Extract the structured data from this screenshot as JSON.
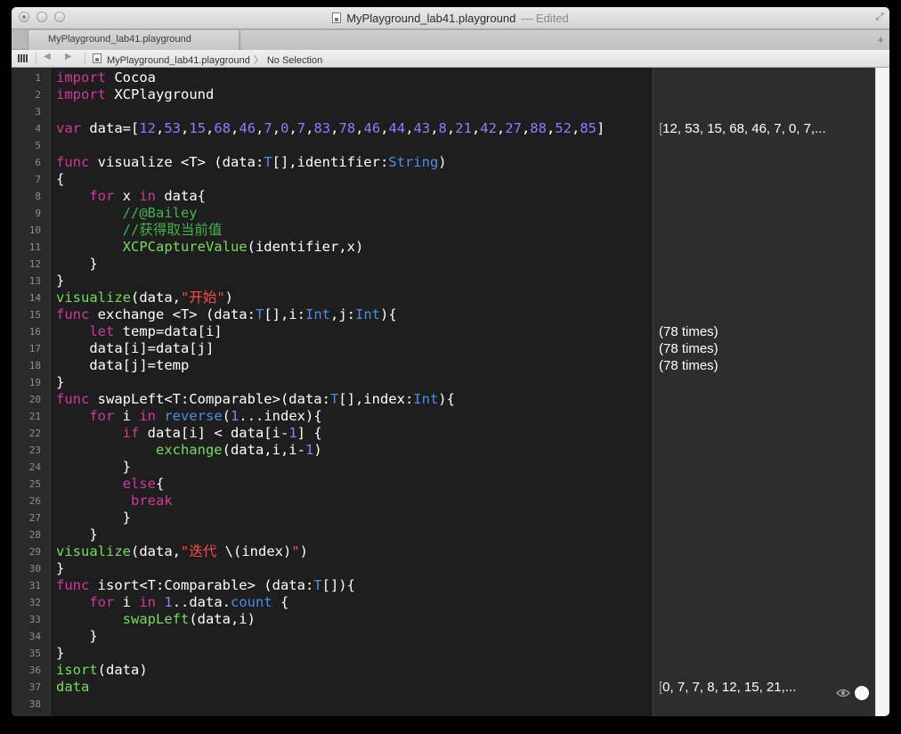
{
  "window": {
    "title": "MyPlayground_lab41.playground",
    "status": "— Edited",
    "tab_label": "MyPlayground_lab41.playground",
    "tab_add": "+"
  },
  "jumpbar": {
    "file": "MyPlayground_lab41.playground",
    "selection": "No Selection",
    "back": "◀",
    "forward": "▶"
  },
  "editor": {
    "line_numbers": [
      "1",
      "2",
      "3",
      "4",
      "5",
      "6",
      "7",
      "8",
      "9",
      "10",
      "11",
      "12",
      "13",
      "14",
      "15",
      "16",
      "17",
      "18",
      "19",
      "20",
      "21",
      "22",
      "23",
      "24",
      "25",
      "26",
      "27",
      "28",
      "29",
      "30",
      "31",
      "32",
      "33",
      "34",
      "35",
      "36",
      "37",
      "38"
    ],
    "lines": [
      [
        {
          "c": "kw",
          "t": "import"
        },
        {
          "c": "pl",
          "t": " Cocoa"
        }
      ],
      [
        {
          "c": "kw",
          "t": "import"
        },
        {
          "c": "pl",
          "t": " XCPlayground"
        }
      ],
      [],
      [
        {
          "c": "kw",
          "t": "var"
        },
        {
          "c": "pl",
          "t": " data=["
        },
        {
          "c": "num",
          "t": "12"
        },
        {
          "c": "pl",
          "t": ","
        },
        {
          "c": "num",
          "t": "53"
        },
        {
          "c": "pl",
          "t": ","
        },
        {
          "c": "num",
          "t": "15"
        },
        {
          "c": "pl",
          "t": ","
        },
        {
          "c": "num",
          "t": "68"
        },
        {
          "c": "pl",
          "t": ","
        },
        {
          "c": "num",
          "t": "46"
        },
        {
          "c": "pl",
          "t": ","
        },
        {
          "c": "num",
          "t": "7"
        },
        {
          "c": "pl",
          "t": ","
        },
        {
          "c": "num",
          "t": "0"
        },
        {
          "c": "pl",
          "t": ","
        },
        {
          "c": "num",
          "t": "7"
        },
        {
          "c": "pl",
          "t": ","
        },
        {
          "c": "num",
          "t": "83"
        },
        {
          "c": "pl",
          "t": ","
        },
        {
          "c": "num",
          "t": "78"
        },
        {
          "c": "pl",
          "t": ","
        },
        {
          "c": "num",
          "t": "46"
        },
        {
          "c": "pl",
          "t": ","
        },
        {
          "c": "num",
          "t": "44"
        },
        {
          "c": "pl",
          "t": ","
        },
        {
          "c": "num",
          "t": "43"
        },
        {
          "c": "pl",
          "t": ","
        },
        {
          "c": "num",
          "t": "8"
        },
        {
          "c": "pl",
          "t": ","
        },
        {
          "c": "num",
          "t": "21"
        },
        {
          "c": "pl",
          "t": ","
        },
        {
          "c": "num",
          "t": "42"
        },
        {
          "c": "pl",
          "t": ","
        },
        {
          "c": "num",
          "t": "27"
        },
        {
          "c": "pl",
          "t": ","
        },
        {
          "c": "num",
          "t": "88"
        },
        {
          "c": "pl",
          "t": ","
        },
        {
          "c": "num",
          "t": "52"
        },
        {
          "c": "pl",
          "t": ","
        },
        {
          "c": "num",
          "t": "85"
        },
        {
          "c": "pl",
          "t": "]"
        }
      ],
      [],
      [
        {
          "c": "kw",
          "t": "func"
        },
        {
          "c": "pl",
          "t": " visualize <T> (data:"
        },
        {
          "c": "ty",
          "t": "T"
        },
        {
          "c": "pl",
          "t": "[],identifier:"
        },
        {
          "c": "ty",
          "t": "String"
        },
        {
          "c": "pl",
          "t": ")"
        }
      ],
      [
        {
          "c": "pl",
          "t": "{"
        }
      ],
      [
        {
          "c": "pl",
          "t": "    "
        },
        {
          "c": "kw",
          "t": "for"
        },
        {
          "c": "pl",
          "t": " x "
        },
        {
          "c": "kw",
          "t": "in"
        },
        {
          "c": "pl",
          "t": " data{"
        }
      ],
      [
        {
          "c": "cm",
          "t": "        //@Bailey"
        }
      ],
      [
        {
          "c": "cm",
          "t": "        //获得取当前值"
        }
      ],
      [
        {
          "c": "pl",
          "t": "        "
        },
        {
          "c": "fn",
          "t": "XCPCaptureValue"
        },
        {
          "c": "pl",
          "t": "(identifier,x)"
        }
      ],
      [
        {
          "c": "pl",
          "t": "    }"
        }
      ],
      [
        {
          "c": "pl",
          "t": "}"
        }
      ],
      [
        {
          "c": "fn",
          "t": "visualize"
        },
        {
          "c": "pl",
          "t": "(data,"
        },
        {
          "c": "str",
          "t": "\"开始\""
        },
        {
          "c": "pl",
          "t": ")"
        }
      ],
      [
        {
          "c": "kw",
          "t": "func"
        },
        {
          "c": "pl",
          "t": " exchange <T> (data:"
        },
        {
          "c": "ty",
          "t": "T"
        },
        {
          "c": "pl",
          "t": "[],i:"
        },
        {
          "c": "ty",
          "t": "Int"
        },
        {
          "c": "pl",
          "t": ",j:"
        },
        {
          "c": "ty",
          "t": "Int"
        },
        {
          "c": "pl",
          "t": "){"
        }
      ],
      [
        {
          "c": "pl",
          "t": "    "
        },
        {
          "c": "kw",
          "t": "let"
        },
        {
          "c": "pl",
          "t": " temp=data[i]"
        }
      ],
      [
        {
          "c": "pl",
          "t": "    data[i]=data[j]"
        }
      ],
      [
        {
          "c": "pl",
          "t": "    data[j]=temp"
        }
      ],
      [
        {
          "c": "pl",
          "t": "}"
        }
      ],
      [
        {
          "c": "kw",
          "t": "func"
        },
        {
          "c": "pl",
          "t": " swapLeft<T:Comparable>(data:"
        },
        {
          "c": "ty",
          "t": "T"
        },
        {
          "c": "pl",
          "t": "[],index:"
        },
        {
          "c": "ty",
          "t": "Int"
        },
        {
          "c": "pl",
          "t": "){"
        }
      ],
      [
        {
          "c": "pl",
          "t": "    "
        },
        {
          "c": "kw",
          "t": "for"
        },
        {
          "c": "pl",
          "t": " i "
        },
        {
          "c": "kw",
          "t": "in"
        },
        {
          "c": "pl",
          "t": " "
        },
        {
          "c": "ty",
          "t": "reverse"
        },
        {
          "c": "pl",
          "t": "("
        },
        {
          "c": "num",
          "t": "1"
        },
        {
          "c": "pl",
          "t": "...index){"
        }
      ],
      [
        {
          "c": "pl",
          "t": "        "
        },
        {
          "c": "kw",
          "t": "if"
        },
        {
          "c": "pl",
          "t": " data[i] < data[i-"
        },
        {
          "c": "num",
          "t": "1"
        },
        {
          "c": "pl",
          "t": "] {"
        }
      ],
      [
        {
          "c": "pl",
          "t": "            "
        },
        {
          "c": "fn",
          "t": "exchange"
        },
        {
          "c": "pl",
          "t": "(data,i,i-"
        },
        {
          "c": "num",
          "t": "1"
        },
        {
          "c": "pl",
          "t": ")"
        }
      ],
      [
        {
          "c": "pl",
          "t": "        }"
        }
      ],
      [
        {
          "c": "pl",
          "t": "        "
        },
        {
          "c": "kw",
          "t": "else"
        },
        {
          "c": "pl",
          "t": "{"
        }
      ],
      [
        {
          "c": "pl",
          "t": "         "
        },
        {
          "c": "kw",
          "t": "break"
        }
      ],
      [
        {
          "c": "pl",
          "t": "        }"
        }
      ],
      [
        {
          "c": "pl",
          "t": "    }"
        }
      ],
      [
        {
          "c": "fn",
          "t": "visualize"
        },
        {
          "c": "pl",
          "t": "(data,"
        },
        {
          "c": "str",
          "t": "\"迭代 "
        },
        {
          "c": "pl",
          "t": "\\(index)"
        },
        {
          "c": "str",
          "t": "\""
        },
        {
          "c": "pl",
          "t": ")"
        }
      ],
      [
        {
          "c": "pl",
          "t": "}"
        }
      ],
      [
        {
          "c": "kw",
          "t": "func"
        },
        {
          "c": "pl",
          "t": " isort<T:Comparable> (data:"
        },
        {
          "c": "ty",
          "t": "T"
        },
        {
          "c": "pl",
          "t": "[]){"
        }
      ],
      [
        {
          "c": "pl",
          "t": "    "
        },
        {
          "c": "kw",
          "t": "for"
        },
        {
          "c": "pl",
          "t": " i "
        },
        {
          "c": "kw",
          "t": "in"
        },
        {
          "c": "pl",
          "t": " "
        },
        {
          "c": "num",
          "t": "1"
        },
        {
          "c": "pl",
          "t": "..data."
        },
        {
          "c": "ty",
          "t": "count"
        },
        {
          "c": "pl",
          "t": " {"
        }
      ],
      [
        {
          "c": "pl",
          "t": "        "
        },
        {
          "c": "fn",
          "t": "swapLeft"
        },
        {
          "c": "pl",
          "t": "(data,i)"
        }
      ],
      [
        {
          "c": "pl",
          "t": "    }"
        }
      ],
      [
        {
          "c": "pl",
          "t": "}"
        }
      ],
      [
        {
          "c": "fn",
          "t": "isort"
        },
        {
          "c": "pl",
          "t": "(data)"
        }
      ],
      [
        {
          "c": "fn",
          "t": "data"
        }
      ],
      []
    ]
  },
  "results": [
    {
      "line": 4,
      "bracket": "[",
      "text": "12, 53, 15, 68, 46, 7, 0, 7,..."
    },
    {
      "line": 16,
      "bracket": "",
      "text": "(78 times)"
    },
    {
      "line": 17,
      "bracket": "",
      "text": "(78 times)"
    },
    {
      "line": 18,
      "bracket": "",
      "text": "(78 times)"
    },
    {
      "line": 37,
      "bracket": "[",
      "text": "0, 7, 7, 8, 12, 15, 21,..."
    }
  ],
  "icons": {
    "quicklook": "eye-icon",
    "value_history": "circle-icon"
  },
  "colors": {
    "keyword": "#d6369c",
    "type": "#4a90e2",
    "number": "#8f7cff",
    "string": "#ff4b4b",
    "comment": "#41b645",
    "function": "#74dd5a",
    "plain": "#ffffff",
    "background": "#1e1e1e"
  }
}
